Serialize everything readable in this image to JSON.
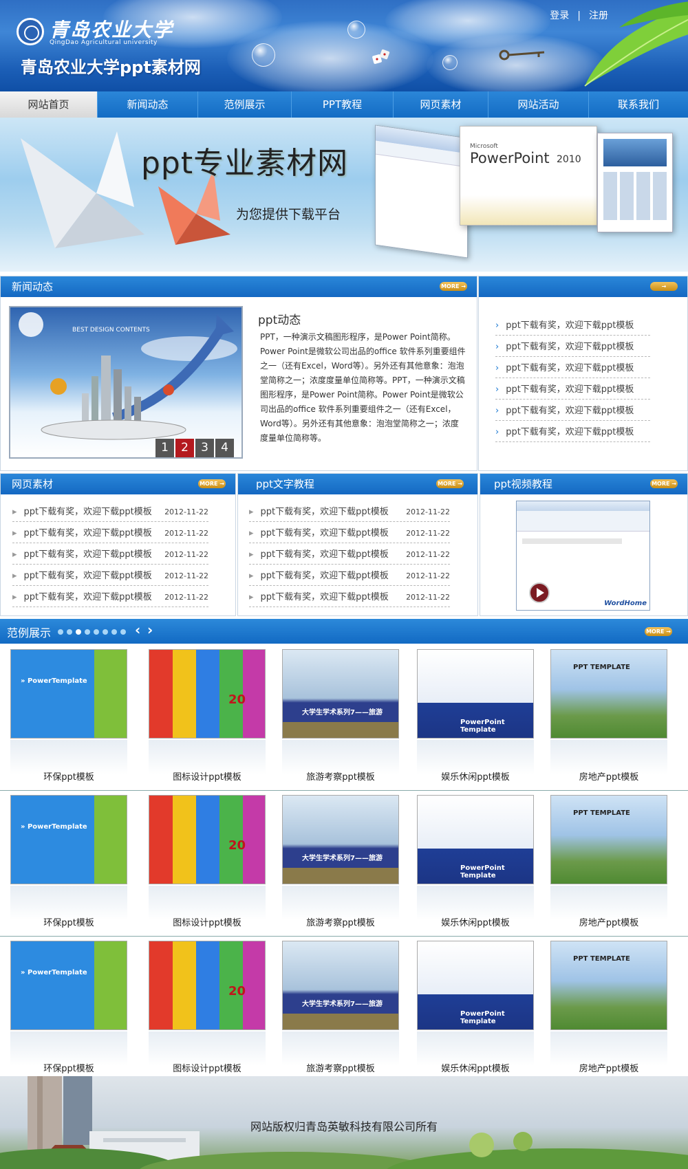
{
  "header": {
    "university_cn": "青岛农业大学",
    "university_en": "QingDao Agricultural university",
    "site_name": "青岛农业大学ppt素材网",
    "login": "登录",
    "separator": "|",
    "register": "注册"
  },
  "nav": {
    "items": [
      {
        "label": "网站首页",
        "active": true
      },
      {
        "label": "新闻动态"
      },
      {
        "label": "范例展示"
      },
      {
        "label": "PPT教程"
      },
      {
        "label": "网页素材"
      },
      {
        "label": "网站活动"
      },
      {
        "label": "联系我们"
      }
    ]
  },
  "banner": {
    "title": "ppt专业素材网",
    "subtitle": "为您提供下载平台",
    "product_brand": "Microsoft",
    "product_name": "PowerPoint",
    "product_year": "2010"
  },
  "news": {
    "title": "新闻动态",
    "more": "MORE →",
    "image_text": "BEST DESIGN CONTENTS",
    "pages": [
      "1",
      "2",
      "3",
      "4"
    ],
    "active_page": "2",
    "article_title": "ppt动态",
    "article_body": "PPT，一种演示文稿图形程序，是Power Point简称。Power Point是微软公司出品的office 软件系列重要组件之一（还有Excel，Word等）。另外还有其他意象：泡泡堂简称之一；浓度度量单位简称等。PPT，一种演示文稿图形程序，是Power Point简称。Power Point是微软公司出品的office 软件系列重要组件之一（还有Excel，Word等）。另外还有其他意象：泡泡堂简称之一；浓度度量单位简称等。"
  },
  "side_list": {
    "more": "→",
    "items": [
      "ppt下载有奖，欢迎下载ppt模板",
      "ppt下载有奖，欢迎下载ppt模板",
      "ppt下载有奖，欢迎下载ppt模板",
      "ppt下载有奖，欢迎下载ppt模板",
      "ppt下载有奖，欢迎下载ppt模板",
      "ppt下载有奖，欢迎下载ppt模板"
    ]
  },
  "web_material": {
    "title": "网页素材",
    "more": "MORE →",
    "items": [
      {
        "text": "ppt下载有奖，欢迎下载ppt模板",
        "date": "2012-11-22"
      },
      {
        "text": "ppt下载有奖，欢迎下载ppt模板",
        "date": "2012-11-22"
      },
      {
        "text": "ppt下载有奖，欢迎下载ppt模板",
        "date": "2012-11-22"
      },
      {
        "text": "ppt下载有奖，欢迎下载ppt模板",
        "date": "2012-11-22"
      },
      {
        "text": "ppt下载有奖，欢迎下载ppt模板",
        "date": "2012-11-22"
      }
    ]
  },
  "text_tutorial": {
    "title": "ppt文字教程",
    "more": "MORE →",
    "items": [
      {
        "text": "ppt下载有奖，欢迎下载ppt模板",
        "date": "2012-11-22"
      },
      {
        "text": "ppt下载有奖，欢迎下载ppt模板",
        "date": "2012-11-22"
      },
      {
        "text": "ppt下载有奖，欢迎下载ppt模板",
        "date": "2012-11-22"
      },
      {
        "text": "ppt下载有奖，欢迎下载ppt模板",
        "date": "2012-11-22"
      },
      {
        "text": "ppt下载有奖，欢迎下载ppt模板",
        "date": "2012-11-22"
      }
    ]
  },
  "video_tutorial": {
    "title": "ppt视频教程",
    "more": "MORE →",
    "watermark": "WordHome"
  },
  "showcase": {
    "title": "范例展示",
    "more": "MORE →",
    "prev": "‹",
    "next": "›",
    "rows": [
      [
        "环保ppt模板",
        "图标设计ppt模板",
        "旅游考察ppt模板",
        "娱乐休闲ppt模板",
        "房地产ppt模板"
      ],
      [
        "环保ppt模板",
        "图标设计ppt模板",
        "旅游考察ppt模板",
        "娱乐休闲ppt模板",
        "房地产ppt模板"
      ],
      [
        "环保ppt模板",
        "图标设计ppt模板",
        "旅游考察ppt模板",
        "娱乐休闲ppt模板",
        "房地产ppt模板"
      ]
    ],
    "thumb_text": {
      "power_template": "» PowerTemplate",
      "calendar": "20",
      "travel": "大学生学术系列7——旅游",
      "pp_template": "PowerPoint Template",
      "house": "PPT TEMPLATE"
    }
  },
  "footer": {
    "copyright": "网站版权归青岛英敏科技有限公司所有"
  },
  "colors": {
    "nav_blue": "#136cc4",
    "header_blue": "#1c5fb7",
    "more_orange": "#d99b22",
    "page_active": "#b4191f"
  }
}
